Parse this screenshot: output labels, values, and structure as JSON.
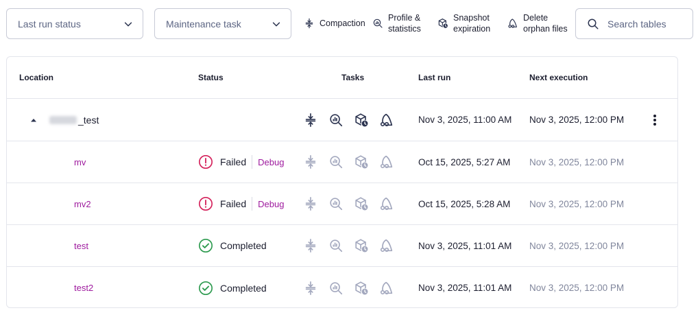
{
  "filters": {
    "last_run_status": "Last run status",
    "maintenance_task": "Maintenance task",
    "compaction": "Compaction",
    "profile_line1": "Profile &",
    "profile_line2": "statistics",
    "snapshot_line1": "Snapshot",
    "snapshot_line2": "expiration",
    "orphan_line1": "Delete",
    "orphan_line2": "orphan files",
    "search_placeholder": "Search tables"
  },
  "table": {
    "headers": {
      "location": "Location",
      "status": "Status",
      "tasks": "Tasks",
      "last_run": "Last run",
      "next_execution": "Next execution"
    },
    "parent": {
      "name_suffix": "_test",
      "last_run": "Nov 3, 2025, 11:00 AM",
      "next_execution": "Nov 3, 2025, 12:00 PM"
    },
    "rows": [
      {
        "name": "mv",
        "status": "Failed",
        "action": "Debug",
        "last_run": "Oct 15, 2025, 5:27 AM",
        "next_execution": "Nov 3, 2025, 12:00 PM"
      },
      {
        "name": "mv2",
        "status": "Failed",
        "action": "Debug",
        "last_run": "Oct 15, 2025, 5:28 AM",
        "next_execution": "Nov 3, 2025, 12:00 PM"
      },
      {
        "name": "test",
        "status": "Completed",
        "last_run": "Nov 3, 2025, 11:01 AM",
        "next_execution": "Nov 3, 2025, 12:00 PM"
      },
      {
        "name": "test2",
        "status": "Completed",
        "last_run": "Nov 3, 2025, 11:01 AM",
        "next_execution": "Nov 3, 2025, 12:00 PM"
      }
    ]
  },
  "colors": {
    "failed": "#d4205a",
    "completed": "#2c9a4e",
    "link": "#9e1a9e",
    "icon_dark": "#2c3450",
    "icon_light": "#a3a8be"
  },
  "icons": [
    "chevron-down-icon",
    "compaction-icon",
    "profile-statistics-icon",
    "snapshot-expiration-icon",
    "delete-orphan-files-icon",
    "search-icon",
    "caret-up-icon",
    "error-icon",
    "check-circle-icon",
    "kebab-menu-icon"
  ]
}
